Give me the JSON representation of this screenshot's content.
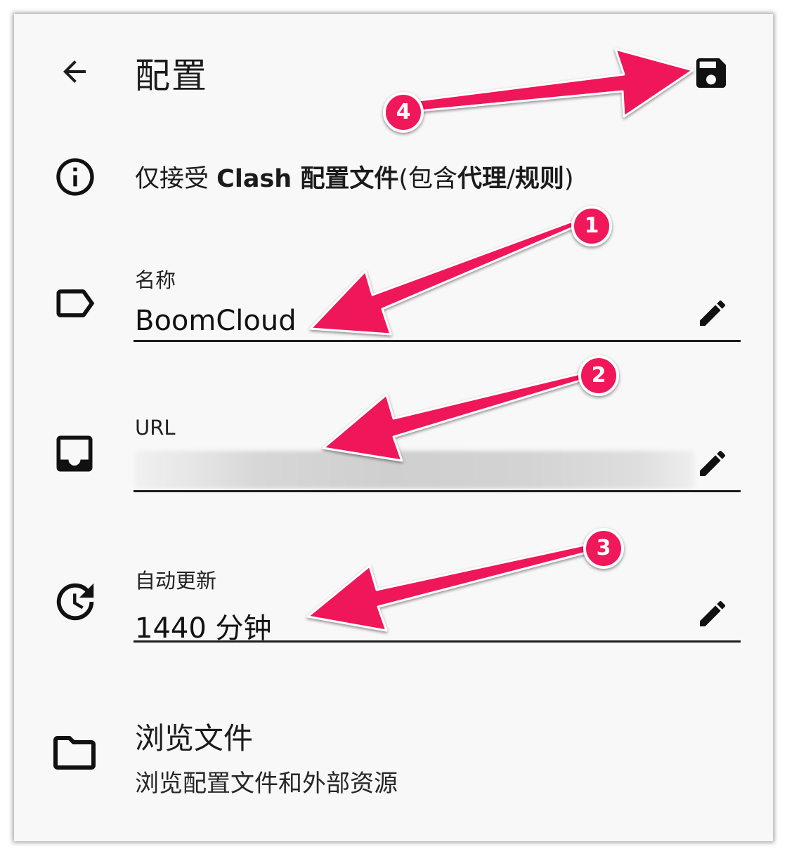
{
  "header": {
    "title": "配置",
    "back_icon": "arrow-left-icon",
    "save_icon": "floppy-save-icon"
  },
  "info": {
    "icon": "info-circle-icon",
    "prefix": "仅接受 ",
    "bold1": "Clash 配置文件",
    "middle": "(包含",
    "bold2": "代理",
    "slash": "/",
    "bold3": "规则",
    "suffix": ")"
  },
  "fields": {
    "name": {
      "label": "名称",
      "value": "BoomCloud",
      "icon": "label-tag-icon",
      "edit_icon": "pencil-icon"
    },
    "url": {
      "label": "URL",
      "value": "",
      "icon": "inbox-tray-icon",
      "edit_icon": "pencil-icon"
    },
    "auto_update": {
      "label": "自动更新",
      "value": "1440 分钟",
      "icon": "history-update-icon",
      "edit_icon": "pencil-icon"
    }
  },
  "browse": {
    "title": "浏览文件",
    "subtitle": "浏览配置文件和外部资源",
    "icon": "folder-icon"
  },
  "annotations": {
    "badges": [
      "1",
      "2",
      "3",
      "4"
    ],
    "color": "#F0175A"
  }
}
